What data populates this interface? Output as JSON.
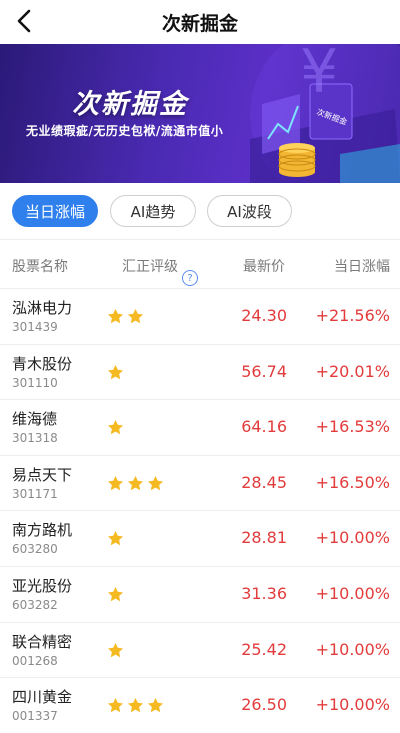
{
  "header": {
    "title": "次新掘金",
    "back_icon": "chevron-left-icon"
  },
  "banner": {
    "title": "次新掘金",
    "subtitle": "无业绩瑕疵/无历史包袱/流通市值小",
    "badge": "次新掘金",
    "colors": {
      "primary": "#4a2ab2",
      "accent": "#f2b632"
    }
  },
  "tabs": [
    {
      "label": "当日涨幅",
      "active": true
    },
    {
      "label": "AI趋势",
      "active": false
    },
    {
      "label": "AI波段",
      "active": false
    }
  ],
  "table": {
    "headers": {
      "name": "股票名称",
      "rating": "汇正评级",
      "price": "最新价",
      "change": "当日涨幅"
    },
    "help_icon": "question-circle-icon",
    "rows": [
      {
        "name": "泓淋电力",
        "code": "301439",
        "stars": 2,
        "price": "24.30",
        "change": "+21.56%"
      },
      {
        "name": "青木股份",
        "code": "301110",
        "stars": 1,
        "price": "56.74",
        "change": "+20.01%"
      },
      {
        "name": "维海德",
        "code": "301318",
        "stars": 1,
        "price": "64.16",
        "change": "+16.53%"
      },
      {
        "name": "易点天下",
        "code": "301171",
        "stars": 3,
        "price": "28.45",
        "change": "+16.50%"
      },
      {
        "name": "南方路机",
        "code": "603280",
        "stars": 1,
        "price": "28.81",
        "change": "+10.00%"
      },
      {
        "name": "亚光股份",
        "code": "603282",
        "stars": 1,
        "price": "31.36",
        "change": "+10.00%"
      },
      {
        "name": "联合精密",
        "code": "001268",
        "stars": 1,
        "price": "25.42",
        "change": "+10.00%"
      },
      {
        "name": "四川黄金",
        "code": "001337",
        "stars": 3,
        "price": "26.50",
        "change": "+10.00%"
      }
    ],
    "colors": {
      "up": "#e23b3b",
      "star": "#f5b921"
    }
  }
}
